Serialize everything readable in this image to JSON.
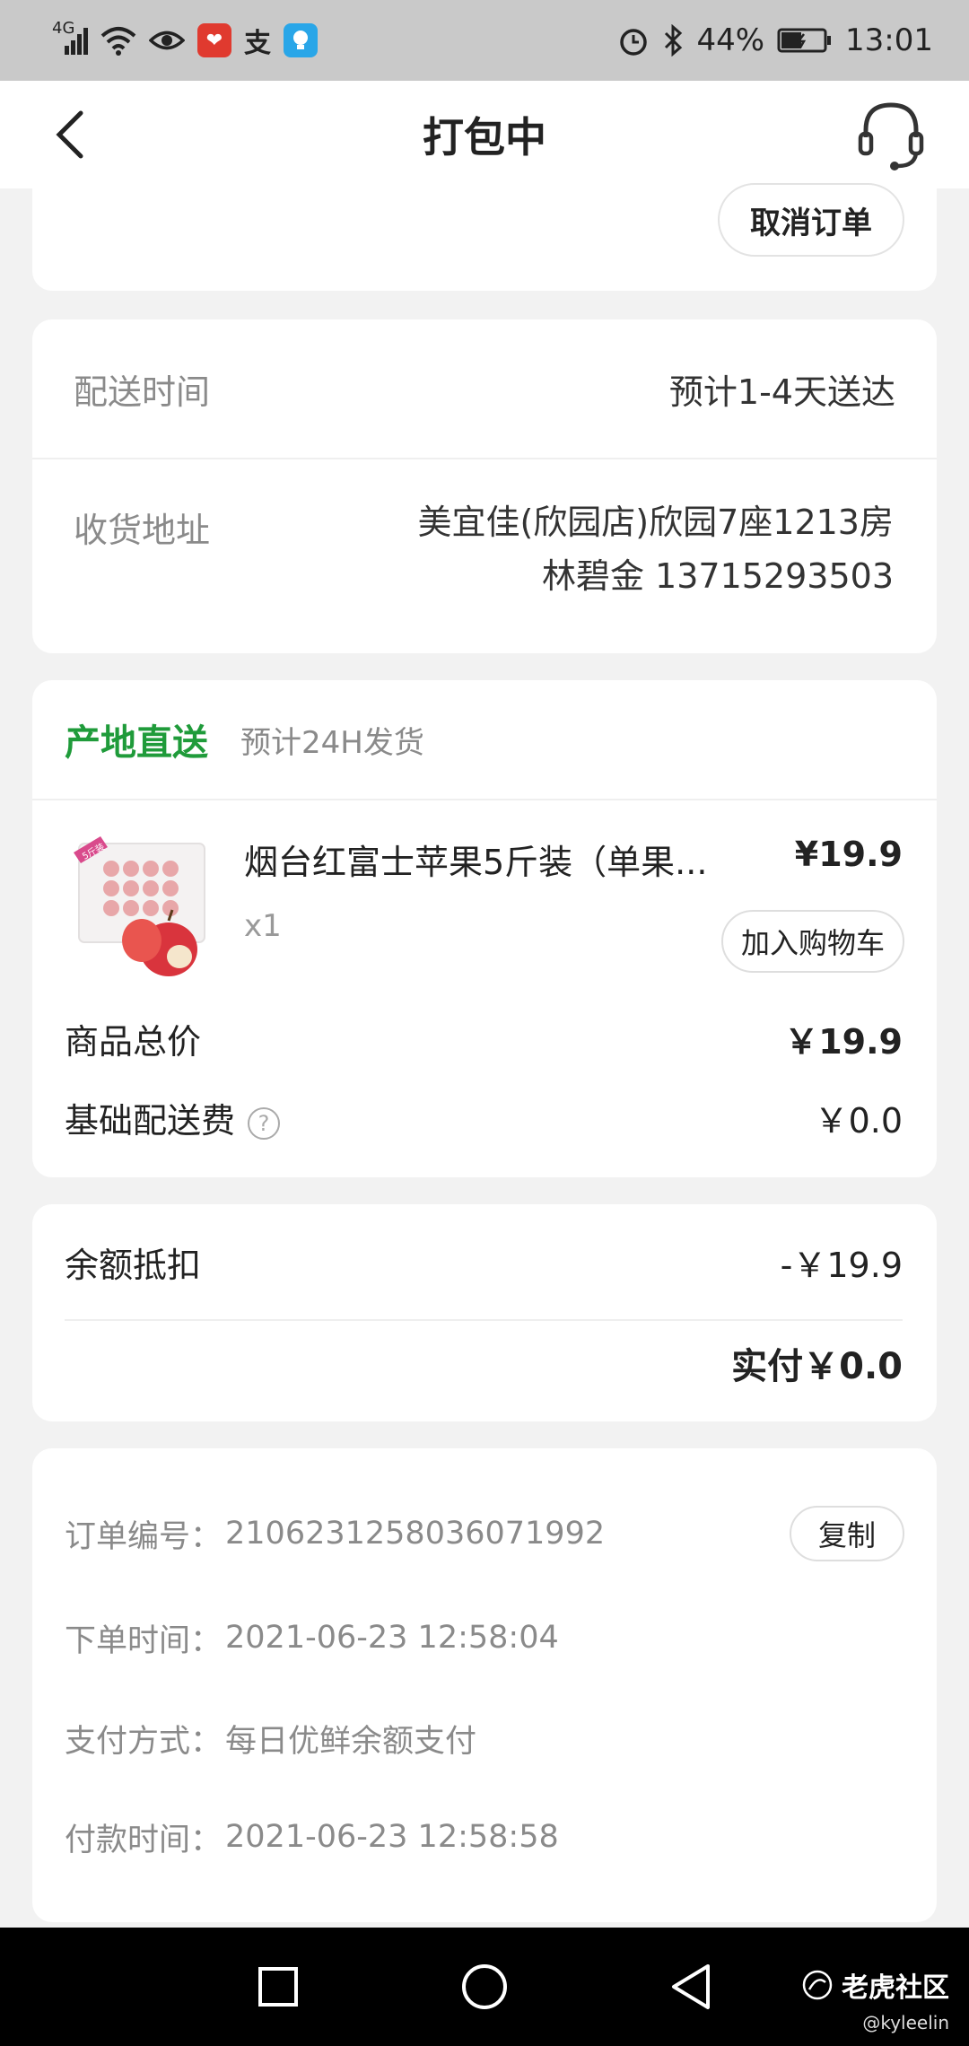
{
  "status_bar": {
    "network": "4G",
    "battery": "44%",
    "time": "13:01"
  },
  "header": {
    "title": "打包中"
  },
  "top_card": {
    "cancel_label": "取消订单"
  },
  "delivery": {
    "time_label": "配送时间",
    "time_value": "预计1-4天送达",
    "address_label": "收货地址",
    "address_line1": "美宜佳(欣园店)欣园7座1213房",
    "address_line2": "林碧金 13715293503"
  },
  "goods": {
    "origin_tag": "产地直送",
    "ship_note": "预计24H发货",
    "product": {
      "thumb_badge": "5斤装",
      "name": "烟台红富士苹果5斤装（单果...",
      "price": "¥19.9",
      "qty": "x1",
      "add_cart_label": "加入购物车"
    },
    "total_label": "商品总价",
    "total_value": "￥19.9",
    "fee_label": "基础配送费",
    "fee_value": "￥0.0"
  },
  "payment": {
    "balance_label": "余额抵扣",
    "balance_value": "-￥19.9",
    "paid_text": "实付￥0.0"
  },
  "order_info": {
    "order_no_label": "订单编号：",
    "order_no": "2106231258036071992",
    "copy_label": "复制",
    "order_time_label": "下单时间：",
    "order_time": "2021-06-23 12:58:04",
    "pay_method_label": "支付方式：",
    "pay_method": "每日优鲜余额支付",
    "pay_time_label": "付款时间：",
    "pay_time": "2021-06-23 12:58:58"
  },
  "watermark": {
    "brand": "老虎社区",
    "user": "@kyleelin"
  },
  "colors": {
    "accent_green": "#1f9b3a",
    "status_bar_bg": "#c9c9c9",
    "page_bg": "#f2f2f2"
  }
}
